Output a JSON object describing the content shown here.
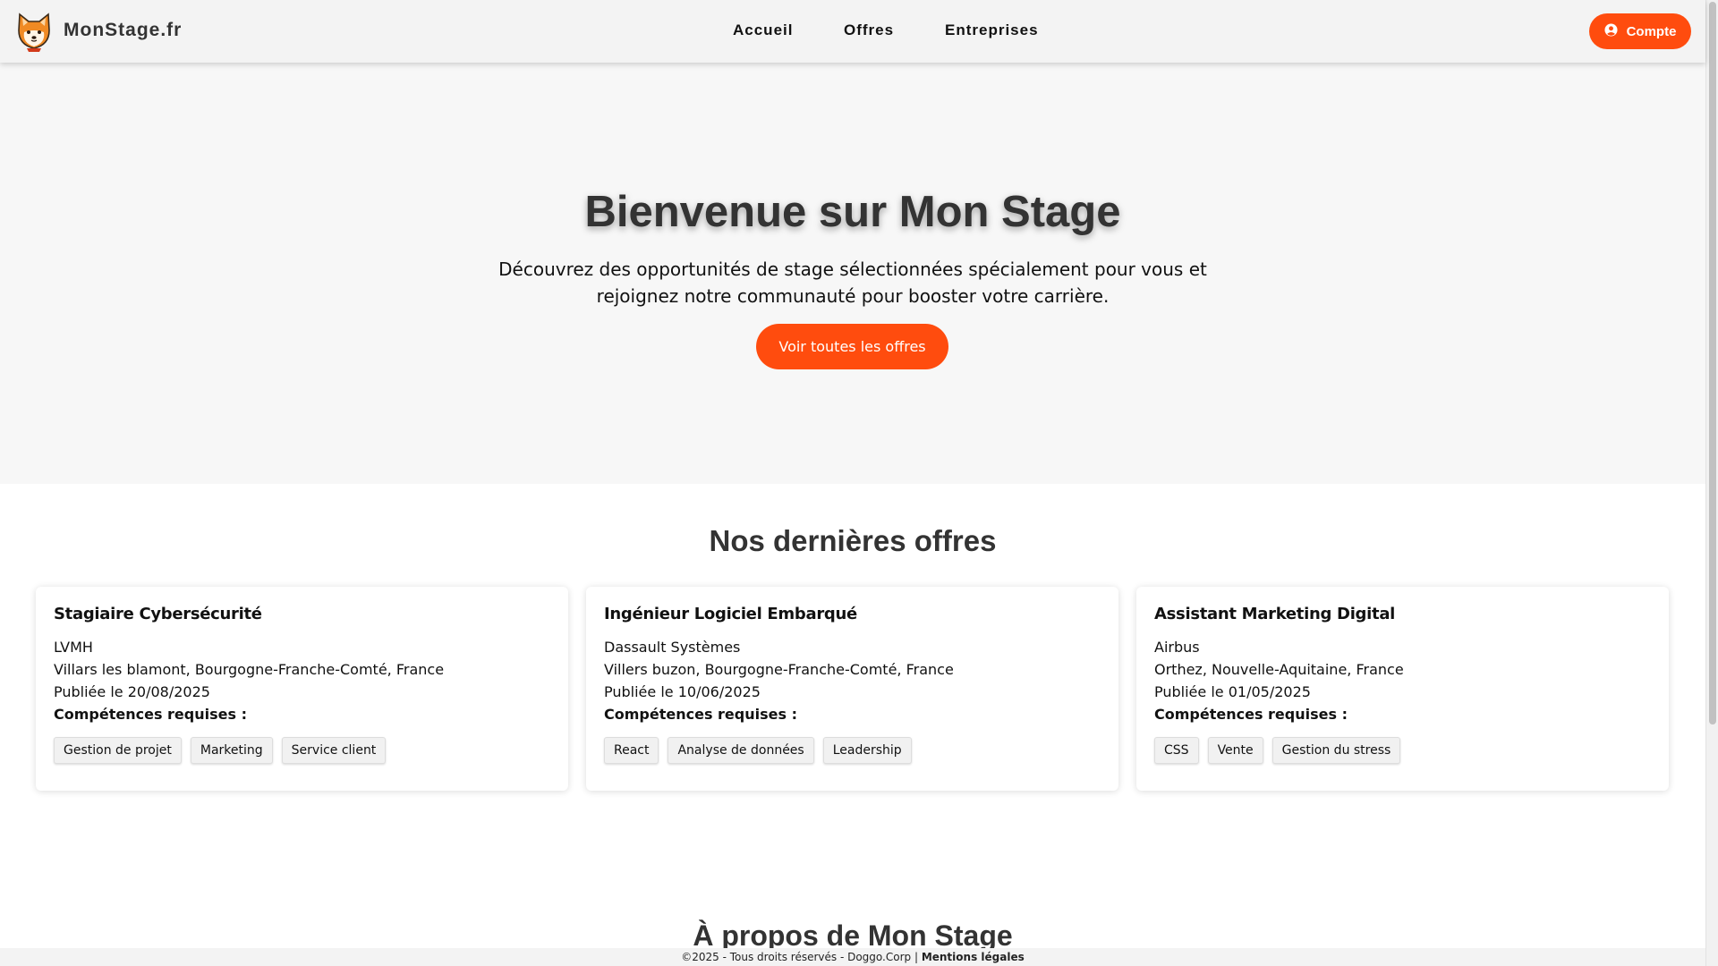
{
  "header": {
    "brand": "MonStage.fr",
    "nav": [
      "Accueil",
      "Offres",
      "Entreprises"
    ],
    "account_label": "Compte"
  },
  "hero": {
    "title": "Bienvenue sur Mon Stage",
    "subtitle": "Découvrez des opportunités de stage sélectionnées spécialement pour vous et rejoignez notre communauté pour booster votre carrière.",
    "cta": "Voir toutes les offres"
  },
  "offers": {
    "title": "Nos dernières offres",
    "skills_label": "Compétences requises :",
    "cards": [
      {
        "title": "Stagiaire Cybersécurité",
        "company": "LVMH",
        "location": "Villars les blamont, Bourgogne-Franche-Comté, France",
        "published": "Publiée le 20/08/2025",
        "skills": [
          "Gestion de projet",
          "Marketing",
          "Service client"
        ]
      },
      {
        "title": "Ingénieur Logiciel Embarqué",
        "company": "Dassault Systèmes",
        "location": "Villers buzon, Bourgogne-Franche-Comté, France",
        "published": "Publiée le 10/06/2025",
        "skills": [
          "React",
          "Analyse de données",
          "Leadership"
        ]
      },
      {
        "title": "Assistant Marketing Digital",
        "company": "Airbus",
        "location": "Orthez, Nouvelle-Aquitaine, France",
        "published": "Publiée le 01/05/2025",
        "skills": [
          "CSS",
          "Vente",
          "Gestion du stress"
        ]
      }
    ]
  },
  "about": {
    "title": "À propos de Mon Stage"
  },
  "footer": {
    "copyright": "©2025 - Tous droits réservés - Doggo.Corp",
    "separator": " | ",
    "legal_link": "Mentions légales"
  },
  "colors": {
    "accent": "#ff4c0e",
    "header_bg": "#f3f3f3",
    "hero_bg": "#f7f7f7"
  },
  "icons": {
    "logo": "shiba-dog-logo",
    "account": "user-circle-icon"
  }
}
